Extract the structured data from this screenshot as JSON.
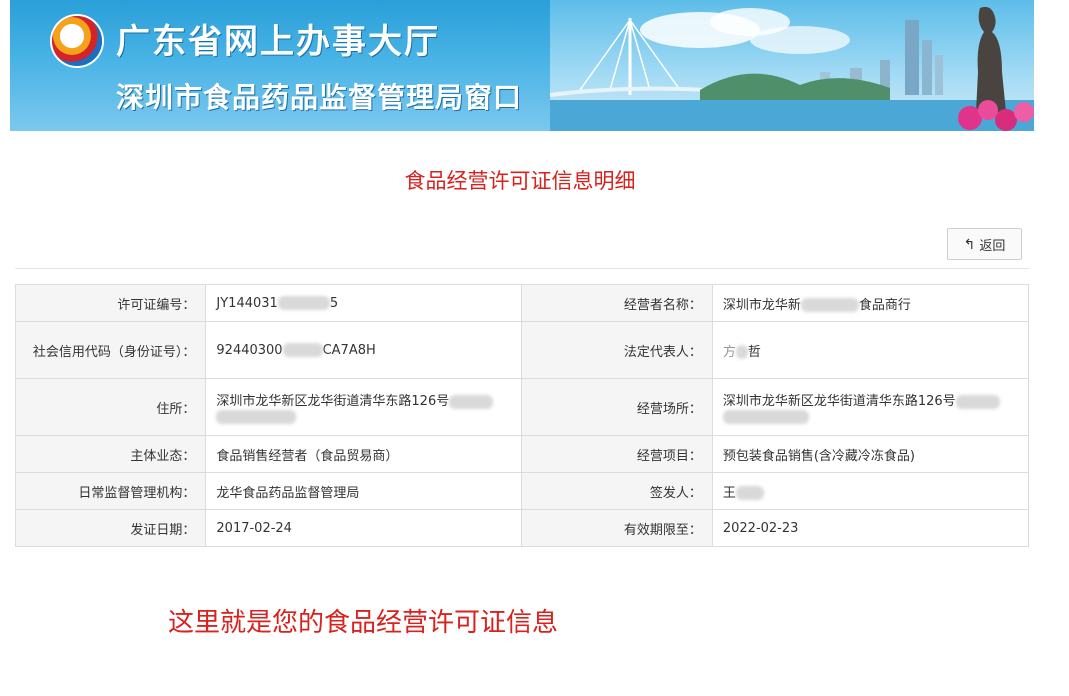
{
  "banner": {
    "title_line1": "广东省网上办事大厅",
    "title_line2": "深圳市食品药品监督管理局窗口"
  },
  "page": {
    "title": "食品经营许可证信息明细",
    "back_label": "返回",
    "note": "这里就是您的食品经营许可证信息"
  },
  "table": {
    "license_no_label": "许可证编号：",
    "license_no_prefix": "JY144031",
    "license_no_suffix": "5",
    "operator_name_label": "经营者名称：",
    "operator_name_prefix": "深圳市龙华新",
    "operator_name_suffix": "食品商行",
    "credit_code_label": "社会信用代码（身份证号）：",
    "credit_code_prefix": "92440300",
    "credit_code_suffix": "CA7A8H",
    "legal_rep_label": "法定代表人：",
    "legal_rep_prefix": "方",
    "legal_rep_suffix": "哲",
    "address_label": "住所：",
    "address_value": "深圳市龙华新区龙华街道清华东路126号",
    "business_place_label": "经营场所：",
    "business_place_value": "深圳市龙华新区龙华街道清华东路126号",
    "entity_type_label": "主体业态：",
    "entity_type_value": "食品销售经营者（食品贸易商）",
    "business_items_label": "经营项目：",
    "business_items_value": "预包装食品销售(含冷藏冷冻食品)",
    "supervision_label": "日常监督管理机构：",
    "supervision_value": "龙华食品药品监督管理局",
    "issuer_label": "签发人：",
    "issuer_prefix": "王",
    "issue_date_label": "发证日期：",
    "issue_date_value": "2017-02-24",
    "expiry_label": "有效期限至：",
    "expiry_value": "2022-02-23"
  },
  "colors": {
    "title_red": "#d9211d",
    "banner_blue": "#2a9fd9"
  },
  "icons": {
    "back": "reply-arrow-icon",
    "logo": "emblem-logo"
  }
}
